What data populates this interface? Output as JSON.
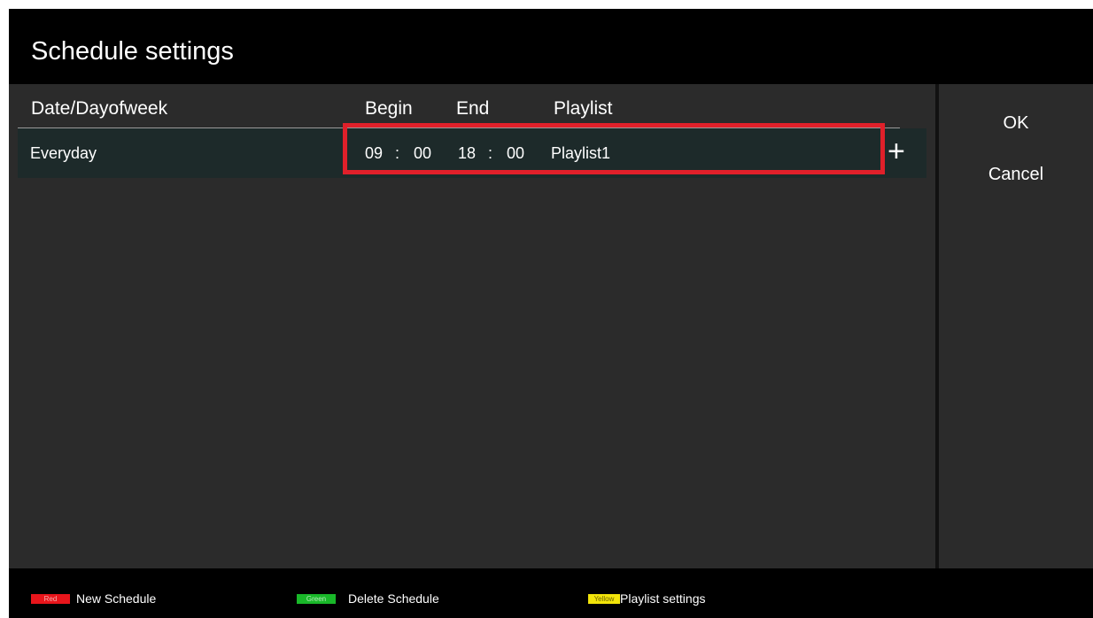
{
  "title": "Schedule settings",
  "columns": {
    "date": "Date/Dayofweek",
    "begin": "Begin",
    "end": "End",
    "playlist": "Playlist"
  },
  "rows": [
    {
      "date": "Everyday",
      "begin_hh": "09",
      "begin_mm": "00",
      "end_hh": "18",
      "end_mm": "00",
      "separator": ":",
      "playlist": "Playlist1"
    }
  ],
  "add_label": "+",
  "side": {
    "ok": "OK",
    "cancel": "Cancel"
  },
  "footer": {
    "red_key": "Red",
    "red_label": "New Schedule",
    "green_key": "Green",
    "green_label": "Delete Schedule",
    "yellow_key": "Yellow",
    "yellow_label": "Playlist settings"
  },
  "colors": {
    "highlight": "#e0202a",
    "red": "#e8151b",
    "green": "#19b829",
    "yellow": "#f2e40a"
  }
}
